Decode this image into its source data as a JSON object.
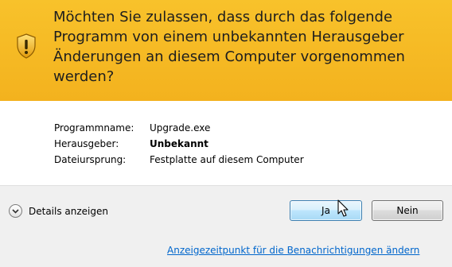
{
  "header": {
    "question": "Möchten Sie zulassen, dass durch das folgende Programm von einem unbekannten Herausgeber Änderungen an diesem Computer vorgenommen werden?",
    "icon": "warning-shield-icon",
    "background_color": "#f6bb24"
  },
  "info": {
    "rows": [
      {
        "label": "Programmname:",
        "value": "Upgrade.exe",
        "bold": false
      },
      {
        "label": "Herausgeber:",
        "value": "Unbekannt",
        "bold": true
      },
      {
        "label": "Dateiursprung:",
        "value": "Festplatte auf diesem Computer",
        "bold": false
      }
    ]
  },
  "footer": {
    "details_label": "Details anzeigen",
    "details_icon": "chevron-down-icon",
    "yes_label": "Ja",
    "no_label": "Nein",
    "notification_link": "Anzeigezeitpunkt für die Benachrichtigungen ändern",
    "link_color": "#0066cc"
  }
}
